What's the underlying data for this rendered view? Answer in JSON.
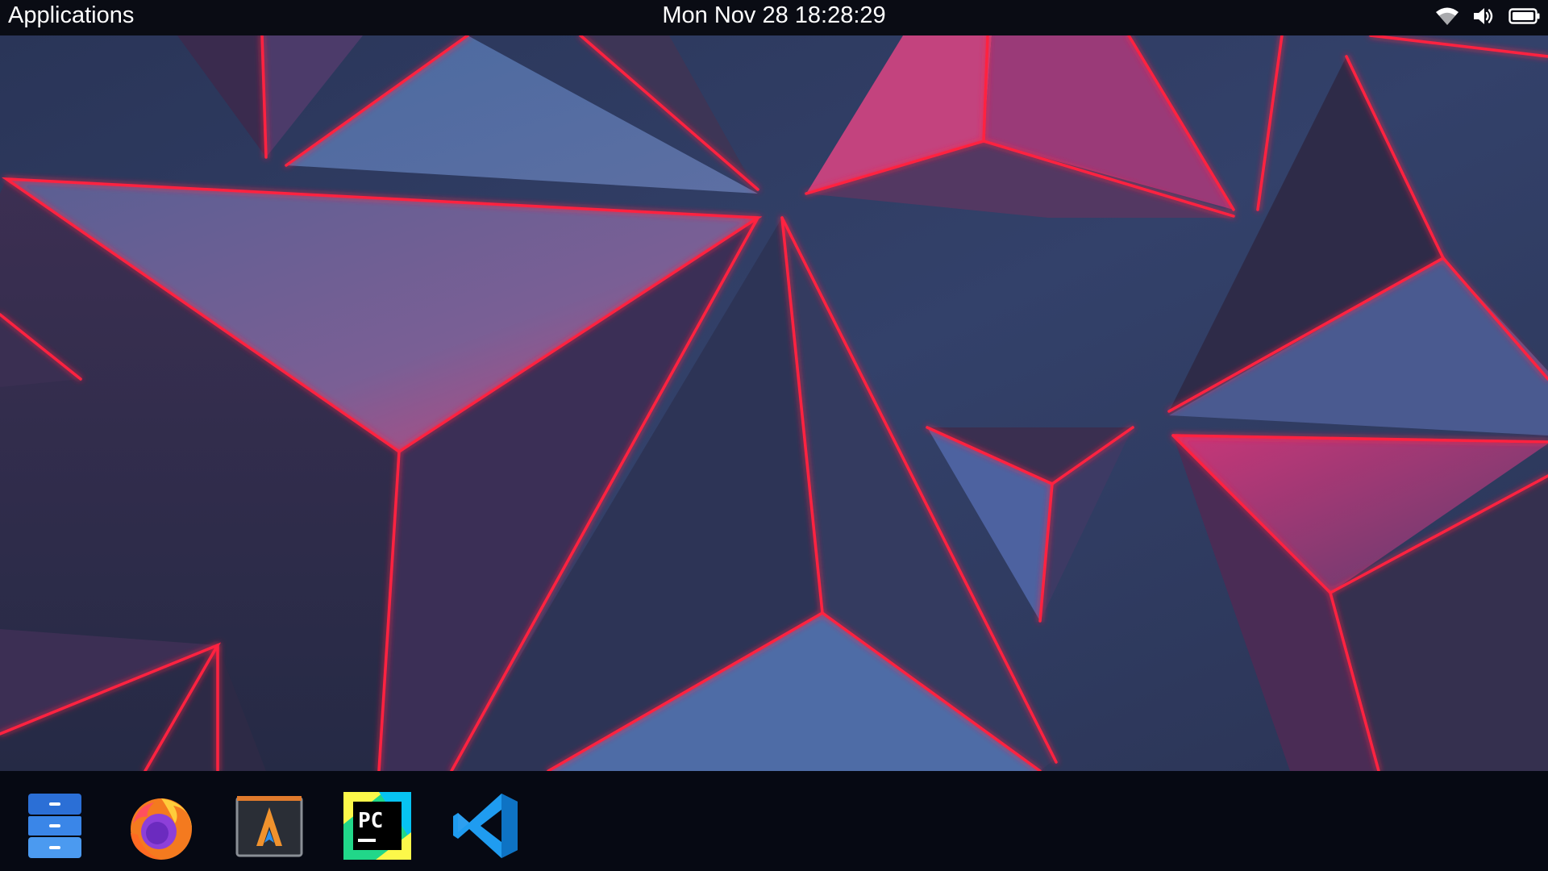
{
  "topbar": {
    "apps_label": "Applications",
    "clock": "Mon Nov 28 18:28:29",
    "tray": {
      "wifi_icon": "wifi-icon",
      "volume_icon": "volume-icon",
      "battery_icon": "battery-icon"
    }
  },
  "wallpaper": {
    "description_icon": "geometric-wallpaper",
    "colors": {
      "base": "#2c3a5c",
      "edge": "#ff2340",
      "accent": "#b02a6a"
    }
  },
  "dock": {
    "items": [
      {
        "name": "Files",
        "icon": "file-cabinet-icon",
        "color": "#2f7fe6"
      },
      {
        "name": "Firefox",
        "icon": "firefox-icon",
        "color": "#f47a1f"
      },
      {
        "name": "Alacritty",
        "icon": "terminal-icon",
        "color": "#f0802a"
      },
      {
        "name": "PyCharm",
        "icon": "pycharm-icon",
        "color": "#21d789"
      },
      {
        "name": "Visual Studio Code",
        "icon": "vscode-icon",
        "color": "#1f9cf0"
      }
    ]
  }
}
